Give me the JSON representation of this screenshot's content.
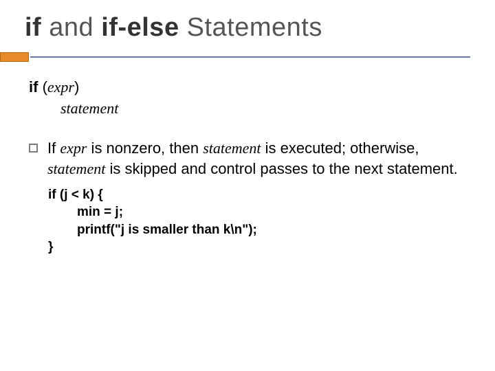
{
  "title": {
    "part1": "if",
    "part2": " and ",
    "part3": "if-else",
    "part4": " Statements"
  },
  "syntax": {
    "ifkw": "if",
    "open": " (",
    "expr": "expr",
    "close": ")",
    "line2": "statement"
  },
  "bullet": {
    "t1": "If ",
    "expr": "expr",
    "t2": " is nonzero, then ",
    "stmt1": "statement",
    "t3": " is executed; otherwise, ",
    "stmt2": "statement",
    "t4": " is skipped and control passes to the next statement."
  },
  "code": {
    "l1": "if (j < k) {",
    "l2": "min = j;",
    "l3": "printf(\"j is smaller than k\\n\");",
    "l4": "}"
  }
}
